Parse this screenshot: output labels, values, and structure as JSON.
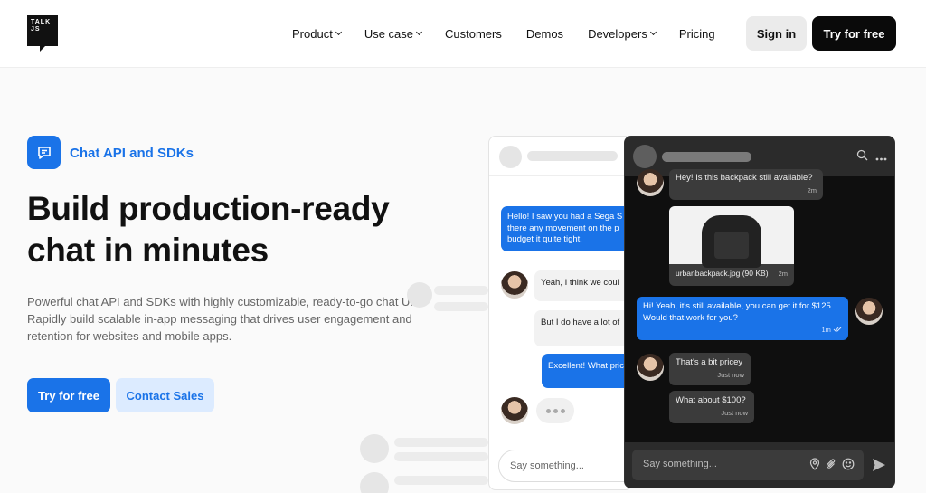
{
  "header": {
    "logo_line1": "TALK",
    "logo_line2": "JS",
    "nav": [
      {
        "label": "Product",
        "dropdown": true
      },
      {
        "label": "Use case",
        "dropdown": true
      },
      {
        "label": "Customers",
        "dropdown": false
      },
      {
        "label": "Demos",
        "dropdown": false
      },
      {
        "label": "Developers",
        "dropdown": true
      },
      {
        "label": "Pricing",
        "dropdown": false
      }
    ],
    "signin_label": "Sign in",
    "try_label": "Try for free"
  },
  "hero": {
    "badge_icon": "chat-bubble-icon",
    "badge_label": "Chat API and SDKs",
    "title_line1": "Build production-ready",
    "title_line2": "chat in minutes",
    "description": "Powerful chat API and SDKs with highly customizable, ready-to-go chat UIs. Rapidly build scalable in-app messaging that drives user engagement and retention for websites and mobile apps.",
    "primary_cta": "Try for free",
    "secondary_cta": "Contact Sales"
  },
  "light_chat": {
    "messages": [
      {
        "text": "Hello! I saw you had a Sega S",
        "text2": "there any movement on the p",
        "text3": "budget it quite tight.",
        "side": "right"
      },
      {
        "text": "Yeah, I think we coul",
        "side": "left"
      },
      {
        "text": "But I do have a lot of",
        "side": "left"
      },
      {
        "text": "Excellent! What pric",
        "side": "right"
      }
    ],
    "input_placeholder": "Say something..."
  },
  "dark_chat": {
    "messages": [
      {
        "text": "Hey! Is this backpack still available?",
        "time": "2m"
      },
      {
        "image_caption": "urbanbackpack.jpg (90 KB)",
        "time": "2m"
      },
      {
        "text": "Hi! Yeah, it's still available, you can get it for $125.",
        "text2": "Would that work for you?",
        "time": "1m"
      },
      {
        "text": "That's a bit pricey",
        "time": "Just now"
      },
      {
        "text": "What about $100?",
        "time": "Just now"
      }
    ],
    "input_placeholder": "Say something..."
  },
  "colors": {
    "accent": "#1a73e8",
    "dark_bg": "#0f0f0f",
    "dark_panel": "#2b2b2b"
  }
}
